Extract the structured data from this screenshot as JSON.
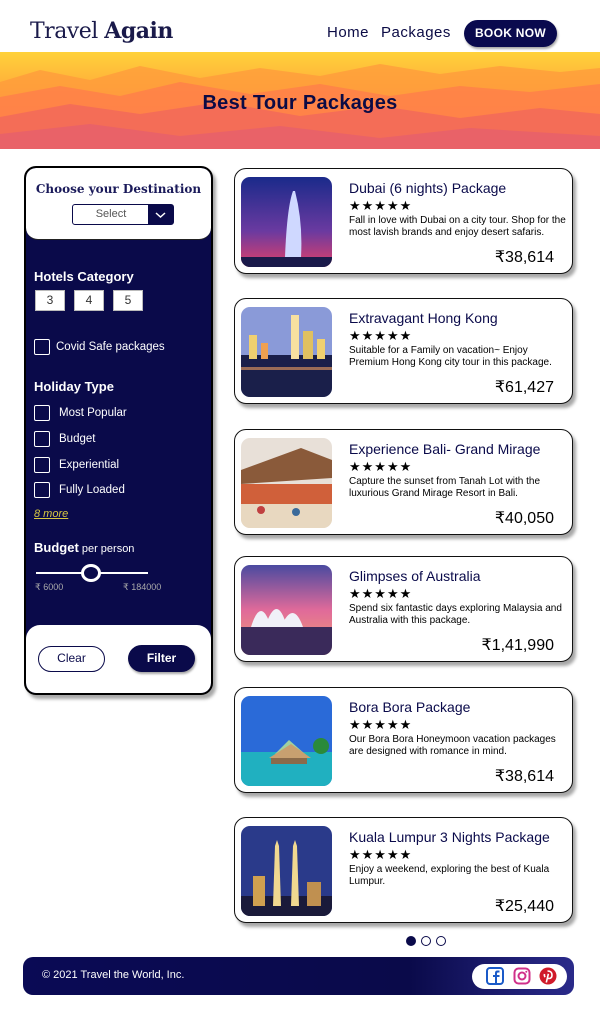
{
  "header": {
    "logo_light": "Travel ",
    "logo_bold": "Again",
    "nav": [
      "Home",
      "Packages"
    ],
    "book_label": "BOOK NOW"
  },
  "banner": {
    "title": "Best Tour Packages"
  },
  "sidebar": {
    "destination_title": "Choose your Destination",
    "select_value": "Select",
    "hotels_title": "Hotels Category",
    "hotel_categories": [
      "3",
      "4",
      "5"
    ],
    "covid_label": "Covid Safe packages",
    "holiday_title": "Holiday Type",
    "holiday_types": [
      "Most Popular",
      "Budget",
      "Experiential",
      "Fully Loaded"
    ],
    "more_link": "8 more",
    "budget_title": "Budget",
    "budget_sub": " per person",
    "budget_min": "₹ 6000",
    "budget_max": "₹ 184000",
    "budget_slider_fraction": 0.5,
    "clear_label": "Clear",
    "filter_label": "Filter"
  },
  "packages": [
    {
      "title": "Dubai (6 nights) Package",
      "stars": "★★★★★",
      "desc": "Fall in love with Dubai on a city tour. Shop for the most lavish brands and enjoy desert safaris.",
      "price": "₹38,614"
    },
    {
      "title": "Extravagant Hong Kong",
      "stars": "★★★★★",
      "desc": "Suitable for a Family on vacation~ Enjoy Premium Hong Kong city tour in this package.",
      "price": "₹61,427"
    },
    {
      "title": "Experience Bali- Grand Mirage",
      "stars": "★★★★★",
      "desc": "Capture the sunset from Tanah Lot with the luxurious Grand Mirage Resort in Bali.",
      "price": "₹40,050"
    },
    {
      "title": "Glimpses of Australia",
      "stars": "★★★★★",
      "desc": "Spend six fantastic days exploring Malaysia and Australia with this package.",
      "price": "₹1,41,990"
    },
    {
      "title": "Bora Bora Package",
      "stars": "★★★★★",
      "desc": "Our Bora Bora Honeymoon vacation packages are designed with romance in mind.",
      "price": "₹38,614"
    },
    {
      "title": "Kuala Lumpur 3 Nights Package",
      "stars": "★★★★★",
      "desc": "Enjoy a weekend, exploring the best of Kuala Lumpur.",
      "price": "₹25,440"
    }
  ],
  "pagination": {
    "pages": 3,
    "current": 1
  },
  "footer": {
    "copyright": "© 2021 Travel the World, Inc.",
    "social": [
      "facebook-icon",
      "instagram-icon",
      "pinterest-icon"
    ]
  },
  "colors": {
    "navy": "#0a0a4a",
    "banner_top": "#ffd23a",
    "banner_bottom": "#f47a6a",
    "link_yellow": "#d8c840"
  }
}
